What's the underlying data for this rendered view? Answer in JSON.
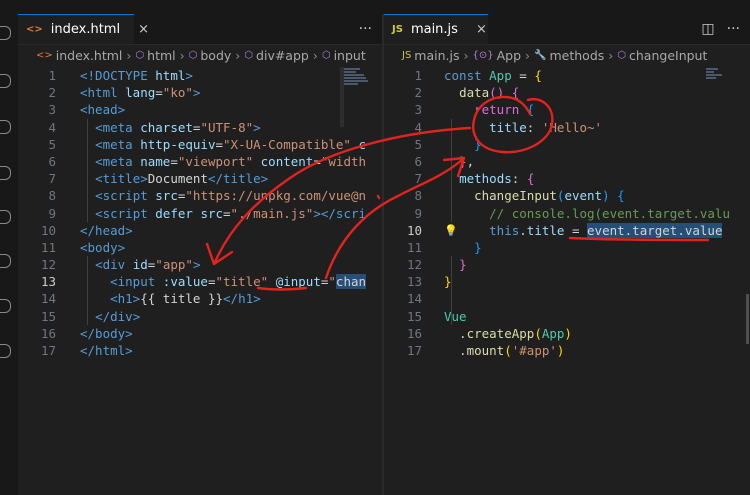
{
  "left_editor": {
    "tab": {
      "icon": "<>",
      "label": "index.html",
      "close": "×"
    },
    "tools": {
      "more": "···"
    },
    "breadcrumb": [
      {
        "icon": "<>",
        "label": "index.html"
      },
      {
        "icon": "⬡",
        "label": "html"
      },
      {
        "icon": "⬡",
        "label": "body"
      },
      {
        "icon": "⬡",
        "label": "div#app"
      },
      {
        "icon": "⬡",
        "label": "input"
      }
    ],
    "lines": [
      {
        "n": "1",
        "tokens": [
          [
            "tg",
            "<!DOCTYPE "
          ],
          [
            "at",
            "html"
          ],
          [
            "tg",
            ">"
          ]
        ]
      },
      {
        "n": "2",
        "tokens": [
          [
            "tg",
            "<html "
          ],
          [
            "at",
            "lang"
          ],
          [
            "tx",
            "="
          ],
          [
            "st",
            "\"ko\""
          ],
          [
            "tg",
            ">"
          ]
        ]
      },
      {
        "n": "3",
        "tokens": [
          [
            "tg",
            "<head>"
          ]
        ]
      },
      {
        "n": "4",
        "tokens": [
          [
            "tx",
            "  "
          ],
          [
            "tg",
            "<meta "
          ],
          [
            "at",
            "charset"
          ],
          [
            "tx",
            "="
          ],
          [
            "st",
            "\"UTF-8\""
          ],
          [
            "tg",
            ">"
          ]
        ]
      },
      {
        "n": "5",
        "tokens": [
          [
            "tx",
            "  "
          ],
          [
            "tg",
            "<meta "
          ],
          [
            "at",
            "http-equiv"
          ],
          [
            "tx",
            "="
          ],
          [
            "st",
            "\"X-UA-Compatible\""
          ],
          [
            "at",
            " c"
          ]
        ]
      },
      {
        "n": "6",
        "tokens": [
          [
            "tx",
            "  "
          ],
          [
            "tg",
            "<meta "
          ],
          [
            "at",
            "name"
          ],
          [
            "tx",
            "="
          ],
          [
            "st",
            "\"viewport\""
          ],
          [
            "at",
            " content"
          ],
          [
            "tx",
            "="
          ],
          [
            "st",
            "\"width"
          ]
        ]
      },
      {
        "n": "7",
        "tokens": [
          [
            "tx",
            "  "
          ],
          [
            "tg",
            "<title>"
          ],
          [
            "tx",
            "Document"
          ],
          [
            "tg",
            "</title>"
          ]
        ]
      },
      {
        "n": "8",
        "tokens": [
          [
            "tx",
            "  "
          ],
          [
            "tg",
            "<script "
          ],
          [
            "at",
            "src"
          ],
          [
            "tx",
            "="
          ],
          [
            "st",
            "\"https://unpkg.com/vue@n"
          ]
        ]
      },
      {
        "n": "9",
        "tokens": [
          [
            "tx",
            "  "
          ],
          [
            "tg",
            "<script "
          ],
          [
            "at",
            "defer "
          ],
          [
            "at",
            "src"
          ],
          [
            "tx",
            "="
          ],
          [
            "st",
            "\"./main.js\""
          ],
          [
            "tg",
            "></"
          ],
          [
            "tg",
            "scri"
          ]
        ]
      },
      {
        "n": "10",
        "tokens": [
          [
            "tg",
            "</head>"
          ]
        ]
      },
      {
        "n": "11",
        "tokens": [
          [
            "tg",
            "<body>"
          ]
        ]
      },
      {
        "n": "12",
        "tokens": [
          [
            "tx",
            "  "
          ],
          [
            "tg",
            "<div "
          ],
          [
            "at",
            "id"
          ],
          [
            "tx",
            "="
          ],
          [
            "st",
            "\"app\""
          ],
          [
            "tg",
            ">"
          ]
        ]
      },
      {
        "n": "13",
        "tokens": [
          [
            "tx",
            "    "
          ],
          [
            "tg",
            "<input "
          ],
          [
            "at",
            ":value"
          ],
          [
            "tx",
            "="
          ],
          [
            "st",
            "\"title\" "
          ],
          [
            "at",
            "@input"
          ],
          [
            "tx",
            "="
          ],
          [
            "st",
            "\""
          ],
          [
            "hl",
            "chan"
          ]
        ]
      },
      {
        "n": "14",
        "tokens": [
          [
            "tx",
            "    "
          ],
          [
            "tg",
            "<h1>"
          ],
          [
            "tx",
            "{{ title }}"
          ],
          [
            "tg",
            "</h1>"
          ]
        ]
      },
      {
        "n": "15",
        "tokens": [
          [
            "tx",
            "  "
          ],
          [
            "tg",
            "</div>"
          ]
        ]
      },
      {
        "n": "16",
        "tokens": [
          [
            "tg",
            "</body>"
          ]
        ]
      },
      {
        "n": "17",
        "tokens": [
          [
            "tg",
            "</html>"
          ]
        ]
      }
    ],
    "active_line": "13"
  },
  "right_editor": {
    "tab": {
      "icon": "JS",
      "label": "main.js",
      "close": "×"
    },
    "tools": {
      "split": "◫",
      "more": "···"
    },
    "breadcrumb": [
      {
        "icon": "JS",
        "label": "main.js"
      },
      {
        "icon": "{⊙}",
        "label": "App"
      },
      {
        "icon": "🔧",
        "label": "methods"
      },
      {
        "icon": "⬡",
        "label": "changeInput"
      }
    ],
    "lines": [
      {
        "n": "1",
        "tokens": [
          [
            "kw",
            "const "
          ],
          [
            "cl",
            "App"
          ],
          [
            "pn",
            " = "
          ],
          [
            "br1",
            "{"
          ]
        ]
      },
      {
        "n": "2",
        "tokens": [
          [
            "tx",
            "  "
          ],
          [
            "fn",
            "data"
          ],
          [
            "br2",
            "()"
          ],
          [
            "pn",
            " "
          ],
          [
            "br2",
            "{"
          ]
        ]
      },
      {
        "n": "3",
        "tokens": [
          [
            "tx",
            "    "
          ],
          [
            "br2",
            "return"
          ],
          [
            "pn",
            " "
          ],
          [
            "br3",
            "{"
          ]
        ]
      },
      {
        "n": "4",
        "tokens": [
          [
            "tx",
            "      "
          ],
          [
            "at",
            "title"
          ],
          [
            "pn",
            ": "
          ],
          [
            "st",
            "'Hello~'"
          ]
        ]
      },
      {
        "n": "5",
        "tokens": [
          [
            "tx",
            "    "
          ],
          [
            "br3",
            "}"
          ]
        ]
      },
      {
        "n": "6",
        "tokens": [
          [
            "tx",
            "  "
          ],
          [
            "br2",
            "}"
          ],
          [
            "pn",
            ","
          ]
        ]
      },
      {
        "n": "7",
        "tokens": [
          [
            "tx",
            "  "
          ],
          [
            "at",
            "methods"
          ],
          [
            "pn",
            ": "
          ],
          [
            "br2",
            "{"
          ]
        ]
      },
      {
        "n": "8",
        "tokens": [
          [
            "tx",
            "    "
          ],
          [
            "fn",
            "changeInput"
          ],
          [
            "br3",
            "("
          ],
          [
            "at",
            "event"
          ],
          [
            "br3",
            ")"
          ],
          [
            "pn",
            " "
          ],
          [
            "br3",
            "{"
          ]
        ]
      },
      {
        "n": "9",
        "tokens": [
          [
            "tx",
            "      "
          ],
          [
            "cm",
            "// console.log(event.target.valu"
          ]
        ]
      },
      {
        "n": "10",
        "tokens": [
          [
            "tx",
            "      "
          ],
          [
            "kw",
            "this"
          ],
          [
            "pn",
            "."
          ],
          [
            "at",
            "title"
          ],
          [
            "pn",
            " = "
          ],
          [
            "hl",
            "event.target.value"
          ]
        ]
      },
      {
        "n": "11",
        "tokens": [
          [
            "tx",
            "    "
          ],
          [
            "br3",
            "}"
          ]
        ]
      },
      {
        "n": "12",
        "tokens": [
          [
            "tx",
            "  "
          ],
          [
            "br2",
            "}"
          ]
        ]
      },
      {
        "n": "13",
        "tokens": [
          [
            "br1",
            "}"
          ]
        ]
      },
      {
        "n": "14",
        "tokens": []
      },
      {
        "n": "15",
        "tokens": [
          [
            "vu",
            "Vue"
          ]
        ]
      },
      {
        "n": "16",
        "tokens": [
          [
            "tx",
            "  ."
          ],
          [
            "fn",
            "createApp"
          ],
          [
            "br1",
            "("
          ],
          [
            "cl",
            "App"
          ],
          [
            "br1",
            ")"
          ]
        ]
      },
      {
        "n": "17",
        "tokens": [
          [
            "tx",
            "  ."
          ],
          [
            "fn",
            "mount"
          ],
          [
            "br1",
            "("
          ],
          [
            "st",
            "'#app'"
          ],
          [
            "br1",
            ")"
          ]
        ]
      }
    ],
    "active_line": "10",
    "lightbulb_icon": "💡"
  },
  "colors": {
    "accent": "#0078d4",
    "annotation": "#e3231d"
  }
}
